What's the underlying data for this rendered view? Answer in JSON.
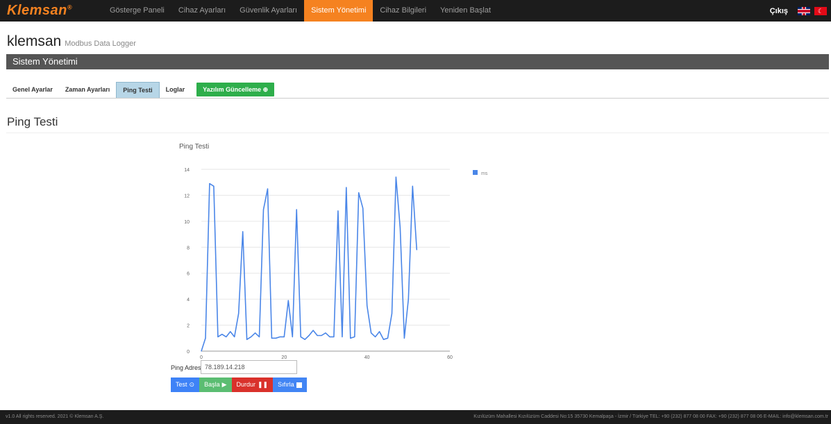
{
  "nav": {
    "logo": "Klemsan",
    "logo_mark": "®",
    "items": [
      {
        "label": "Gösterge Paneli",
        "active": false
      },
      {
        "label": "Cihaz Ayarları",
        "active": false
      },
      {
        "label": "Güvenlik Ayarları",
        "active": false
      },
      {
        "label": "Sistem Yönetimi",
        "active": true
      },
      {
        "label": "Cihaz Bilgileri",
        "active": false
      },
      {
        "label": "Yeniden Başlat",
        "active": false
      }
    ],
    "logout": "Çıkış",
    "flags": [
      "flag-uk-icon",
      "flag-tr-icon"
    ]
  },
  "brand": {
    "name": "klemsan",
    "subtitle": "Modbus Data Logger"
  },
  "section_title": "Sistem Yönetimi",
  "tabs": [
    {
      "label": "Genel Ayarlar",
      "active": false
    },
    {
      "label": "Zaman Ayarları",
      "active": false
    },
    {
      "label": "Ping Testi",
      "active": true
    },
    {
      "label": "Loglar",
      "active": false
    },
    {
      "label": "Yazılım Güncelleme ⊕",
      "active": false
    }
  ],
  "page_heading": "Ping Testi",
  "chart_data": {
    "type": "line",
    "title": "Ping Testi",
    "xlabel": "",
    "ylabel": "",
    "xlim": [
      0,
      60
    ],
    "ylim": [
      0,
      14
    ],
    "x_ticks": [
      0,
      20,
      40,
      60
    ],
    "y_ticks": [
      0,
      2,
      4,
      6,
      8,
      10,
      12,
      14
    ],
    "grid": true,
    "legend_position": "right",
    "series": [
      {
        "name": "ms",
        "color": "#4a86e8",
        "x": [
          0,
          1,
          2,
          3,
          4,
          5,
          6,
          7,
          8,
          9,
          10,
          11,
          12,
          13,
          14,
          15,
          16,
          17,
          18,
          19,
          20,
          21,
          22,
          23,
          24,
          25,
          26,
          27,
          28,
          29,
          30,
          31,
          32,
          33,
          34,
          35,
          36,
          37,
          38,
          39,
          40,
          41,
          42,
          43,
          44,
          45,
          46,
          47,
          48,
          49,
          50,
          51,
          52
        ],
        "values": [
          0,
          1,
          12.9,
          12.7,
          1.1,
          1.3,
          1.1,
          1.5,
          1.1,
          2.9,
          9.2,
          0.9,
          1.1,
          1.4,
          1.1,
          10.9,
          12.5,
          1.0,
          1.0,
          1.1,
          1.1,
          3.9,
          1.1,
          10.9,
          1.1,
          0.9,
          1.2,
          1.6,
          1.2,
          1.2,
          1.4,
          1.1,
          1.1,
          10.8,
          1.1,
          12.6,
          1.0,
          1.1,
          12.2,
          11.0,
          3.5,
          1.4,
          1.1,
          1.5,
          0.9,
          1.0,
          2.9,
          13.4,
          9.5,
          1.0,
          4.0,
          12.7,
          7.8
        ]
      }
    ]
  },
  "controls": {
    "ping_label": "Ping Adresi",
    "ping_value": "78.189.14.218",
    "buttons": {
      "test": "Test",
      "basla": "Başla",
      "durdur": "Durdur",
      "sifirla": "Sıfırla"
    }
  },
  "footer": {
    "left": "v1.0 All rights reserved. 2021 © Klemsan A.Ş.",
    "right": "Kızılüzüm Mahallesi Kızılüzüm Caddesi No:15 35730 Kemalpaşa - İzmir / Türkiye TEL: +90 (232) 877 08 00 FAX: +90 (232) 877 08 06 E-MAIL: info@klemsan.com.tr"
  }
}
